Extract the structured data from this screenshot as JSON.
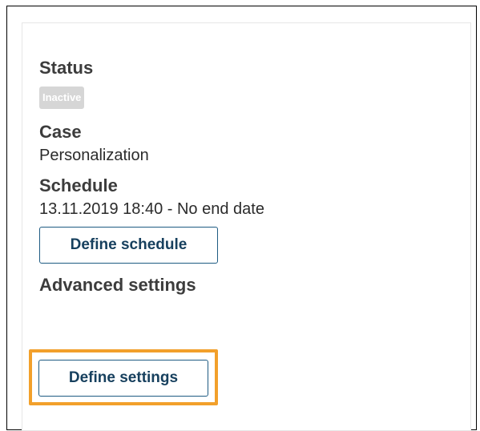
{
  "panel": {
    "status": {
      "label": "Status",
      "badge": "Inactive",
      "badge_color": "#d6d6d6"
    },
    "case": {
      "label": "Case",
      "value": "Personalization"
    },
    "schedule": {
      "label": "Schedule",
      "value": "13.11.2019 18:40 - No end date",
      "button_label": "Define schedule"
    },
    "advanced": {
      "label": "Advanced settings",
      "button_label": "Define settings",
      "highlight_color": "#f2a02b"
    }
  }
}
